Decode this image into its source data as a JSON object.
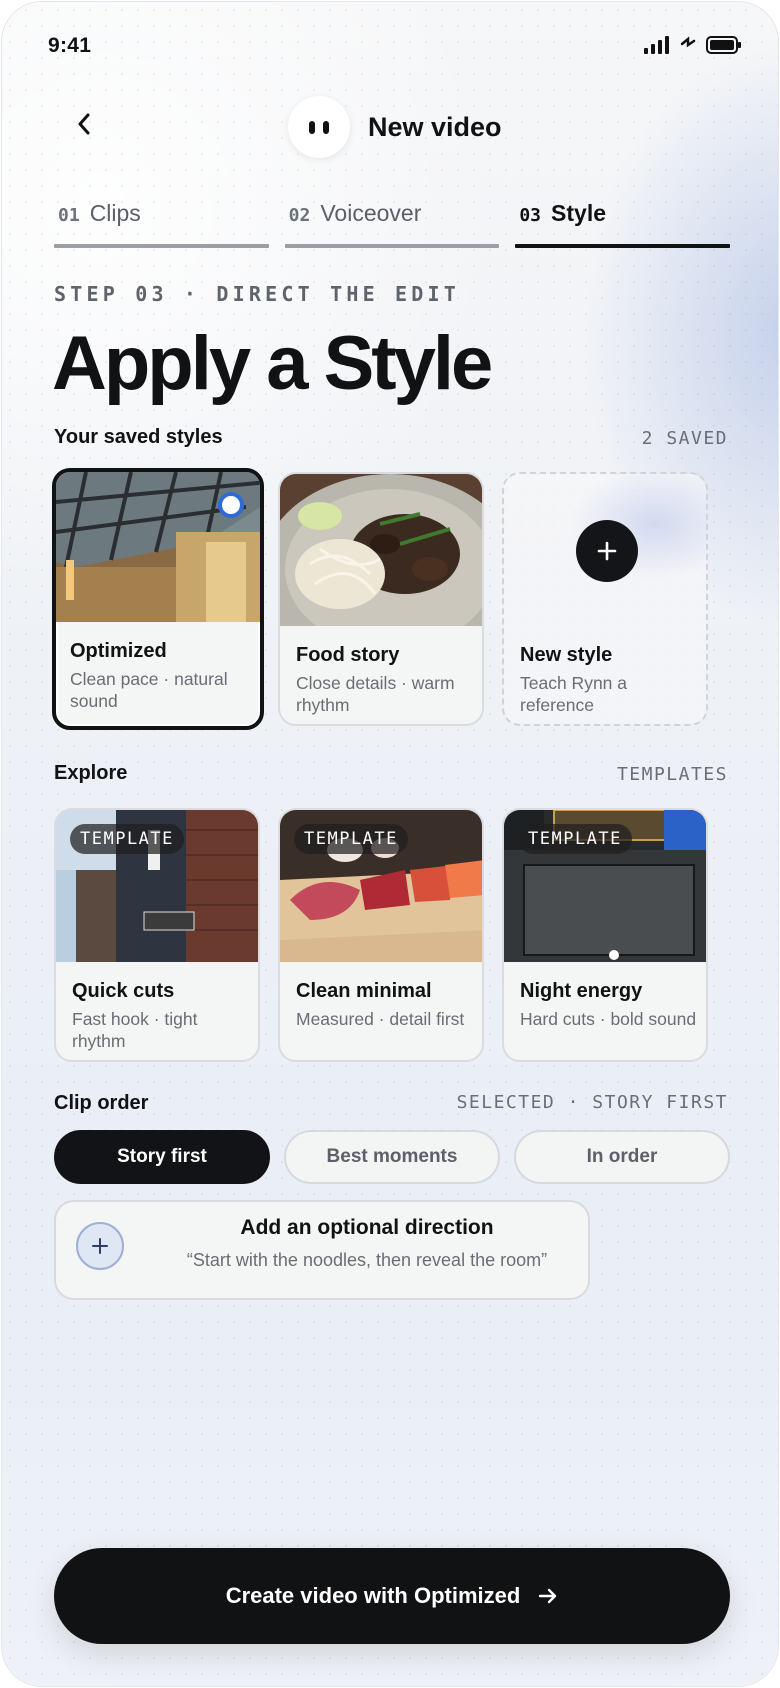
{
  "status": {
    "time": "9:41"
  },
  "header": {
    "title": "New video",
    "back_icon": "chevron-left-icon",
    "logo_icon": "app-logo-icon"
  },
  "steps": [
    {
      "num": "01",
      "label": "Clips",
      "active": false
    },
    {
      "num": "02",
      "label": "Voiceover",
      "active": false
    },
    {
      "num": "03",
      "label": "Style",
      "active": true
    }
  ],
  "eyebrow": "STEP 03 · DIRECT THE EDIT",
  "heading": "Apply a Style",
  "saved": {
    "title": "Your saved styles",
    "meta": "2 SAVED",
    "cards": [
      {
        "title": "Optimized",
        "sub": "Clean pace · natural sound",
        "selected": true
      },
      {
        "title": "Food story",
        "sub": "Close details · warm rhythm",
        "selected": false
      },
      {
        "title": "New style",
        "sub": "Teach Rynn a reference",
        "selected": false
      }
    ]
  },
  "explore": {
    "title": "Explore",
    "meta": "TEMPLATES",
    "tag": "TEMPLATE",
    "cards": [
      {
        "title": "Quick cuts",
        "sub": "Fast hook · tight rhythm"
      },
      {
        "title": "Clean minimal",
        "sub": "Measured · detail first"
      },
      {
        "title": "Night energy",
        "sub": "Hard cuts · bold sound"
      }
    ]
  },
  "clip_order": {
    "title": "Clip order",
    "meta": "SELECTED · STORY FIRST",
    "options": [
      "Story first",
      "Best moments",
      "In order"
    ],
    "selected": "Story first"
  },
  "direction": {
    "title": "Add an optional direction",
    "placeholder": "“Start with the noodles, then reveal the room”"
  },
  "cta": {
    "label": "Create video with Optimized",
    "icon": "arrow-right-icon"
  },
  "colors": {
    "accent": "#111214",
    "selection_ring": "#2f6bd8"
  }
}
